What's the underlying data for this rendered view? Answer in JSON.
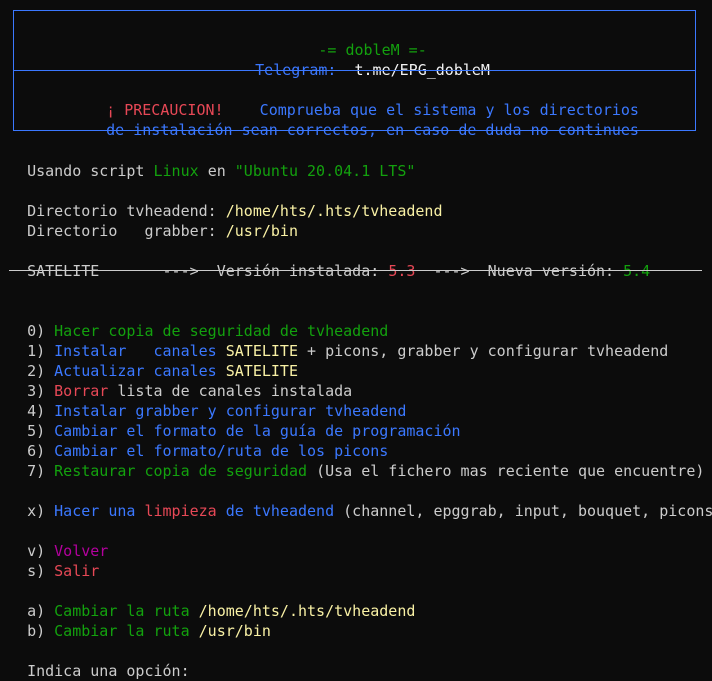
{
  "banner": {
    "title": "-= dobleM =-",
    "telegram_label": "Telegram:",
    "telegram_link": "t.me/EPG_dobleM",
    "warning_label": "¡ PRECAUCION!",
    "warning_text_1": "Comprueba que el sistema y los directorios",
    "warning_text_2": "de instalación sean correctos, en caso de duda no continues"
  },
  "info": {
    "using_prefix": "Usando script",
    "os_type": "Linux",
    "using_in": "en",
    "distro": "\"Ubuntu 20.04.1 LTS\"",
    "tvh_dir_label": "Directorio tvheadend:",
    "tvh_dir": "/home/hts/.hts/tvheadend",
    "grabber_dir_label": "Directorio   grabber:",
    "grabber_dir": "/usr/bin"
  },
  "version": {
    "list_name": "SATELITE",
    "arrow1": "--->",
    "installed_label": "Versión instalada:",
    "installed_value": "5.3",
    "arrow2": "--->",
    "new_label": "Nueva versión:",
    "new_value": "5.4"
  },
  "menu": {
    "opt0_key": "0)",
    "opt0_text": "Hacer copia de seguridad de tvheadend",
    "opt1_key": "1)",
    "opt1_a": "Instalar   canales",
    "opt1_b": "SATELITE",
    "opt1_c": "+ picons, grabber y configurar tvheadend",
    "opt2_key": "2)",
    "opt2_a": "Actualizar canales",
    "opt2_b": "SATELITE",
    "opt3_key": "3)",
    "opt3_a": "Borrar",
    "opt3_b": "lista de canales instalada",
    "opt4_key": "4)",
    "opt4_text": "Instalar grabber y configurar tvheadend",
    "opt5_key": "5)",
    "opt5_text": "Cambiar el formato de la guía de programación",
    "opt6_key": "6)",
    "opt6_text": "Cambiar el formato/ruta de los picons",
    "opt7_key": "7)",
    "opt7_a": "Restaurar copia de seguridad",
    "opt7_b": "(Usa el fichero mas reciente que encuentre)",
    "optx_key": "x)",
    "optx_a": "Hacer una",
    "optx_b": "limpieza",
    "optx_c": "de tvheadend",
    "optx_d": "(channel, epggrab, input, bouquet, picons)",
    "optv_key": "v)",
    "optv_text": "Volver",
    "opts_key": "s)",
    "opts_text": "Salir",
    "opta_key": "a)",
    "opta_a": "Cambiar la ruta",
    "opta_b": "/home/hts/.hts/tvheadend",
    "optb_key": "b)",
    "optb_a": "Cambiar la ruta",
    "optb_b": "/usr/bin"
  },
  "prompt": {
    "text": "Indica una opción:"
  }
}
